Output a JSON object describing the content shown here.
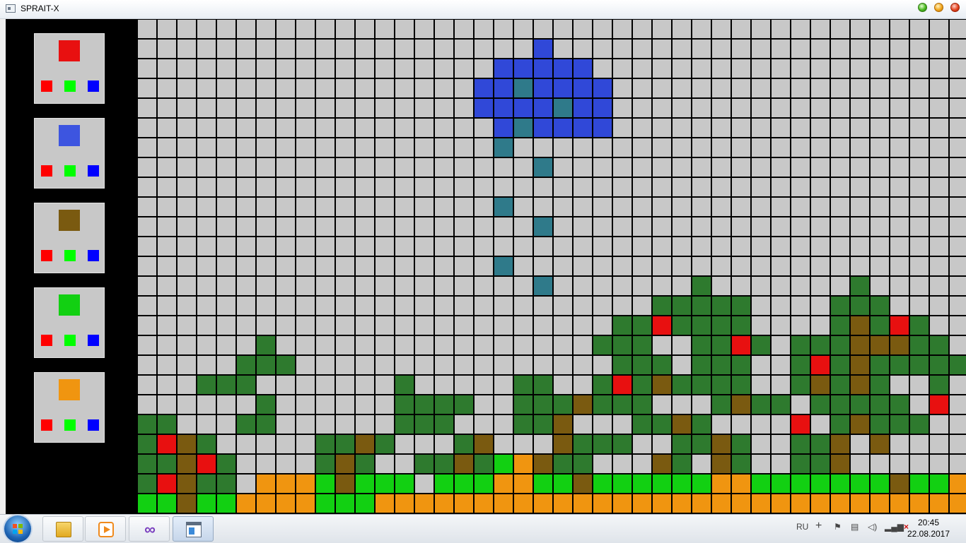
{
  "window": {
    "title": "SPRAIT-X",
    "icon": "app-window-icon"
  },
  "window_controls": [
    "minimize-button",
    "maximize-button",
    "close-button"
  ],
  "palette": [
    {
      "color": "#e81010",
      "name": "red"
    },
    {
      "color": "#3d55e0",
      "name": "blue"
    },
    {
      "color": "#7a5a10",
      "name": "brown"
    },
    {
      "color": "#12d012",
      "name": "green"
    },
    {
      "color": "#f09510",
      "name": "orange"
    }
  ],
  "channel_colors": {
    "r": "#ff0000",
    "g": "#00ff00",
    "b": "#0000ff"
  },
  "canvas": {
    "columns": 42,
    "rows": 25,
    "legend": {
      ".": "#c8c8c8",
      "B": "#3048d8",
      "T": "#2f7a8a",
      "G": "#2e7a2e",
      "N": "#7a5a10",
      "R": "#e81010",
      "L": "#12d012",
      "O": "#f09510"
    },
    "rows_data": [
      "..........................................",
      "....................B.....................",
      "..................BBBBB...................",
      ".................BBTBBBB..................",
      ".................BBBBTBB..................",
      "..................BTBBBB..................",
      "..................T.......................",
      "....................T.....................",
      "..........................................",
      "..................T.......................",
      "....................T.....................",
      "..........................................",
      "..................T.......................",
      "....................T.......G.......G.....",
      "..........................GGGGG....GGG....",
      "........................GGRGGGG....GNGRG..",
      "......G................GGG..GGRG.GGGNNNGG.",
      ".....GGG................GGG.GGG..GRGNGGGGG",
      "...GGG.......G.....GG..GRGNGGGG..GNGNG..G.",
      "......G......GGGG..GGGNGGG...GNGG.GGGGG.R.",
      "GG...GG......GGG...GGN...GGNG....R.GNGGG..",
      "GRNG.....GGNG...GN...NGGG..GGNG..GGN.N....",
      "GGNRG....GNG..GGNGLONGG...NG.NG..GGN......",
      "GRNGG.OOOLNLLL.LLLOOLLNLLLLLLOOLLLLLLLNLLOO",
      "LLNLLOOOOLLLOOOOOOOOOOOOOOOOOOOOOOOOOOOOOO"
    ]
  },
  "taskbar": {
    "start": "windows-start-orb",
    "apps": [
      {
        "name": "explorer-icon"
      },
      {
        "name": "media-player-icon"
      },
      {
        "name": "visual-studio-icon"
      },
      {
        "name": "sprait-x-window-icon",
        "active": true
      }
    ],
    "tray": {
      "language": "RU",
      "icons": [
        "plus-icon",
        "action-center-flag-icon",
        "clipboard-icon",
        "volume-icon",
        "network-disconnected-icon"
      ]
    },
    "clock": {
      "time": "20:45",
      "date": "22.08.2017"
    }
  }
}
